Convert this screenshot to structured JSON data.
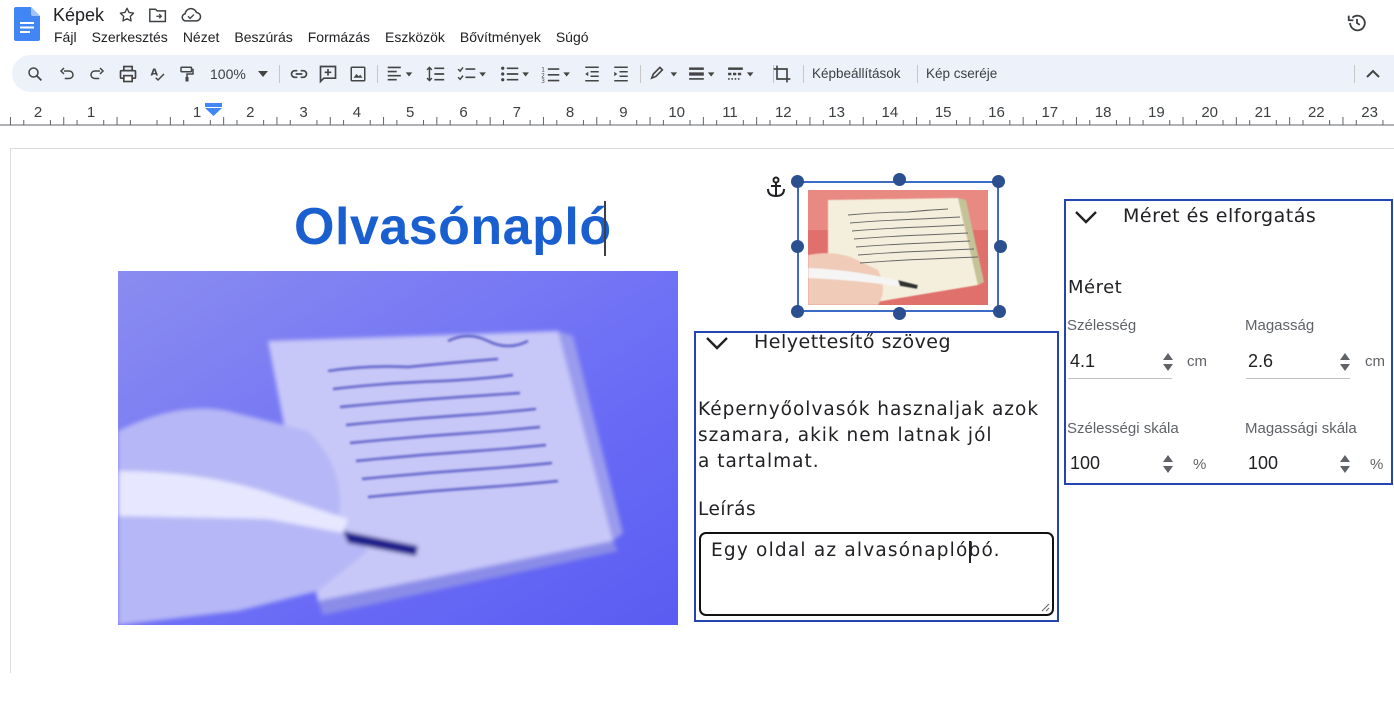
{
  "app": {
    "doc_title": "Képek",
    "menu": [
      "Fájl",
      "Szerkesztés",
      "Nézet",
      "Beszúrás",
      "Formázás",
      "Eszközök",
      "Bővítmények",
      "Súgó"
    ]
  },
  "toolbar": {
    "zoom": "100%",
    "image_options": "Képbeállítások",
    "replace_image": "Kép cseréje"
  },
  "ruler": {
    "labels": [
      "2",
      "1",
      "1",
      "2",
      "3",
      "4",
      "5",
      "6",
      "7",
      "8",
      "9",
      "10",
      "11",
      "12",
      "13",
      "14",
      "15",
      "16",
      "17",
      "18",
      "19",
      "20",
      "21",
      "22",
      "23"
    ]
  },
  "document": {
    "heading": "Olvasónapló"
  },
  "alt_text_panel": {
    "title": "Helyettesítő szöveg",
    "body_lines": [
      "Képernyőolvasók hasznaljak azok",
      "szamara, akik nem latnak jól",
      "a tartalmat."
    ],
    "description_label": "Leírás",
    "description_value": "Egy oldal az alvasónaplóbó."
  },
  "size_panel": {
    "title": "Méret és elforgatás",
    "section": "Méret",
    "width_label": "Szélesség",
    "width_value": "4.1",
    "width_unit": "cm",
    "height_label": "Magasság",
    "height_value": "2.6",
    "height_unit": "cm",
    "width_scale_label": "Szélességi skála",
    "width_scale_value": "100",
    "width_scale_unit": "%",
    "height_scale_label": "Magassági skála",
    "height_scale_value": "100",
    "height_scale_unit": "%"
  },
  "colors": {
    "heading": "#1a5fd0",
    "panel_border": "#2444b0",
    "selection_handle": "#2c4f8f",
    "toolbar_bg": "#edf2fa"
  }
}
